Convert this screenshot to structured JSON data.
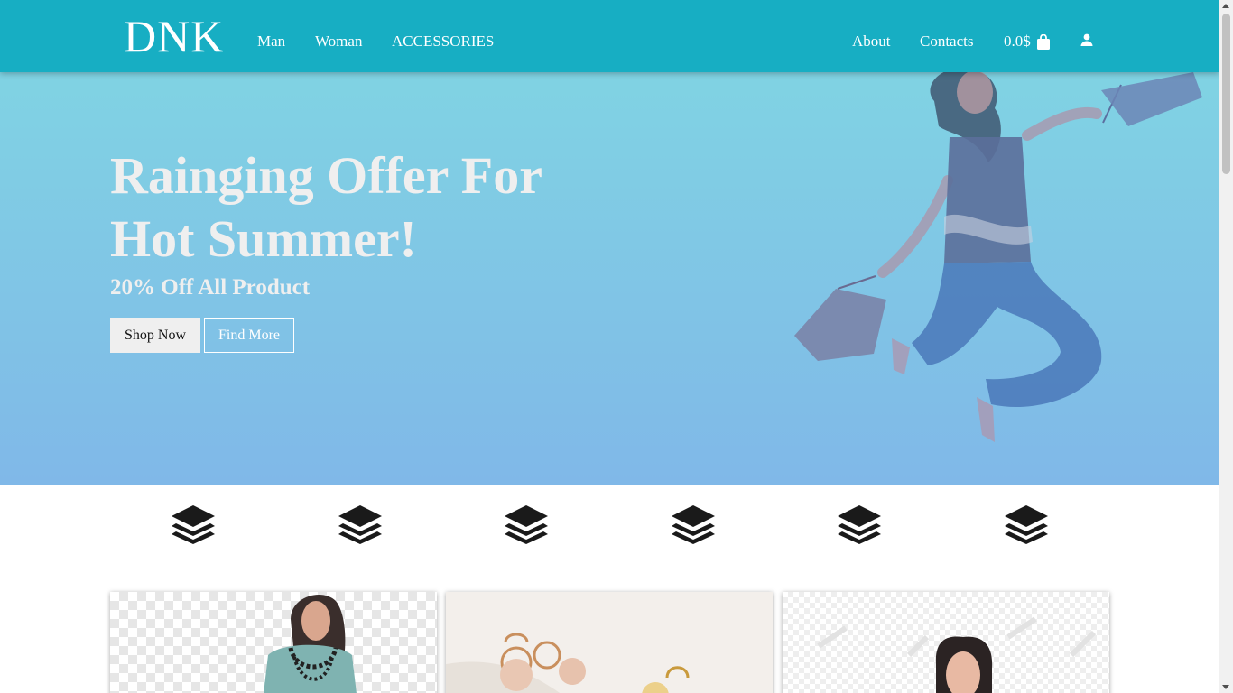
{
  "brand": {
    "logo": "DNK"
  },
  "nav": {
    "links": [
      "Man",
      "Woman",
      "ACCESSORIES"
    ],
    "right_links": [
      "About",
      "Contacts"
    ],
    "cart_total": "0.0$",
    "cart_icon": "shopping-bag-icon",
    "user_icon": "user-icon"
  },
  "hero": {
    "title_line1": "Rainging Offer For",
    "title_line2": "Hot Summer!",
    "subtitle": "20% Off All Product",
    "primary_button": "Shop Now",
    "secondary_button": "Find More"
  },
  "features": {
    "icon": "layer-group-icon",
    "count": 6
  },
  "colors": {
    "header": "#17aec3",
    "hero_top": "#80d3e3",
    "hero_bottom": "#80b8e8",
    "hero_text": "#efefef",
    "icon": "#1a1a1a"
  }
}
